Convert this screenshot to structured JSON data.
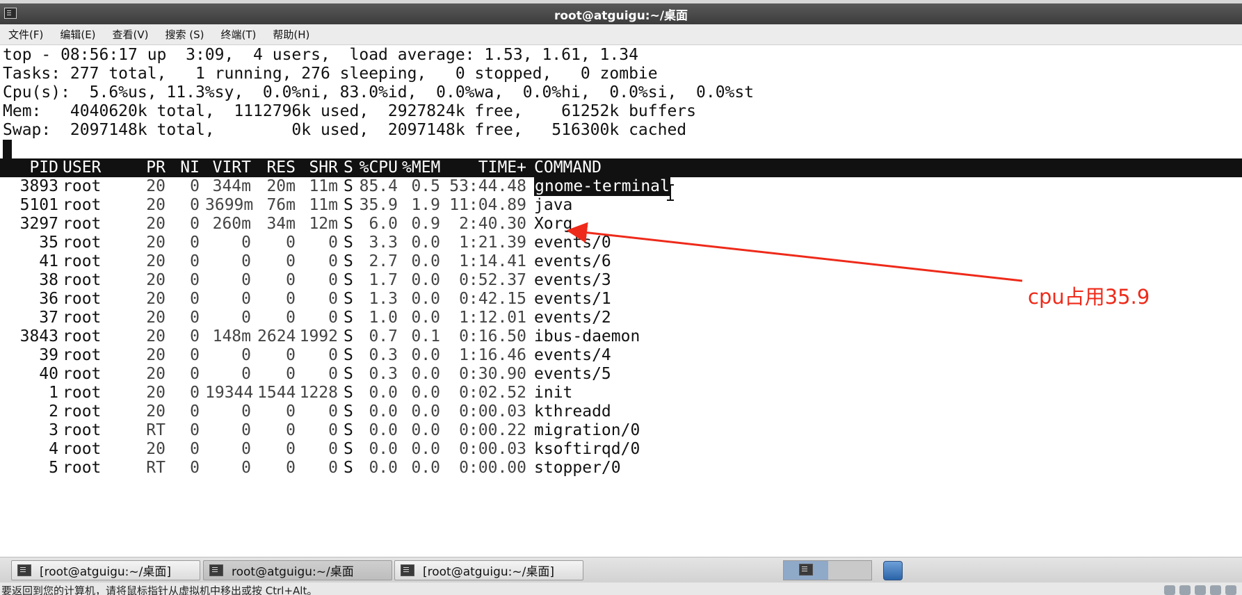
{
  "window": {
    "title": "root@atguigu:~/桌面"
  },
  "menubar": {
    "items": [
      "文件(F)",
      "编辑(E)",
      "查看(V)",
      "搜索 (S)",
      "终端(T)",
      "帮助(H)"
    ]
  },
  "top_summary": {
    "line1": "top - 08:56:17 up  3:09,  4 users,  load average: 1.53, 1.61, 1.34",
    "line2": "Tasks: 277 total,   1 running, 276 sleeping,   0 stopped,   0 zombie",
    "line3": "Cpu(s):  5.6%us, 11.3%sy,  0.0%ni, 83.0%id,  0.0%wa,  0.0%hi,  0.0%si,  0.0%st",
    "line4": "Mem:   4040620k total,  1112796k used,  2927824k free,    61252k buffers",
    "line5": "Swap:  2097148k total,        0k used,  2097148k free,   516300k cached"
  },
  "process_table": {
    "columns": [
      "PID",
      "USER",
      "PR",
      "NI",
      "VIRT",
      "RES",
      "SHR",
      "S",
      "%CPU",
      "%MEM",
      "TIME+",
      "COMMAND"
    ],
    "rows": [
      {
        "pid": "3893",
        "user": "root",
        "pr": "20",
        "ni": "0",
        "virt": "344m",
        "res": "20m",
        "shr": "11m",
        "s": "S",
        "cpu": "85.4",
        "mem": "0.5",
        "time": "53:44.48",
        "command": "gnome-terminal",
        "selected": true
      },
      {
        "pid": "5101",
        "user": "root",
        "pr": "20",
        "ni": "0",
        "virt": "3699m",
        "res": "76m",
        "shr": "11m",
        "s": "S",
        "cpu": "35.9",
        "mem": "1.9",
        "time": "11:04.89",
        "command": "java"
      },
      {
        "pid": "3297",
        "user": "root",
        "pr": "20",
        "ni": "0",
        "virt": "260m",
        "res": "34m",
        "shr": "12m",
        "s": "S",
        "cpu": "6.0",
        "mem": "0.9",
        "time": "2:40.30",
        "command": "Xorg"
      },
      {
        "pid": "35",
        "user": "root",
        "pr": "20",
        "ni": "0",
        "virt": "0",
        "res": "0",
        "shr": "0",
        "s": "S",
        "cpu": "3.3",
        "mem": "0.0",
        "time": "1:21.39",
        "command": "events/0"
      },
      {
        "pid": "41",
        "user": "root",
        "pr": "20",
        "ni": "0",
        "virt": "0",
        "res": "0",
        "shr": "0",
        "s": "S",
        "cpu": "2.7",
        "mem": "0.0",
        "time": "1:14.41",
        "command": "events/6"
      },
      {
        "pid": "38",
        "user": "root",
        "pr": "20",
        "ni": "0",
        "virt": "0",
        "res": "0",
        "shr": "0",
        "s": "S",
        "cpu": "1.7",
        "mem": "0.0",
        "time": "0:52.37",
        "command": "events/3"
      },
      {
        "pid": "36",
        "user": "root",
        "pr": "20",
        "ni": "0",
        "virt": "0",
        "res": "0",
        "shr": "0",
        "s": "S",
        "cpu": "1.3",
        "mem": "0.0",
        "time": "0:42.15",
        "command": "events/1"
      },
      {
        "pid": "37",
        "user": "root",
        "pr": "20",
        "ni": "0",
        "virt": "0",
        "res": "0",
        "shr": "0",
        "s": "S",
        "cpu": "1.0",
        "mem": "0.0",
        "time": "1:12.01",
        "command": "events/2"
      },
      {
        "pid": "3843",
        "user": "root",
        "pr": "20",
        "ni": "0",
        "virt": "148m",
        "res": "2624",
        "shr": "1992",
        "s": "S",
        "cpu": "0.7",
        "mem": "0.1",
        "time": "0:16.50",
        "command": "ibus-daemon"
      },
      {
        "pid": "39",
        "user": "root",
        "pr": "20",
        "ni": "0",
        "virt": "0",
        "res": "0",
        "shr": "0",
        "s": "S",
        "cpu": "0.3",
        "mem": "0.0",
        "time": "1:16.46",
        "command": "events/4"
      },
      {
        "pid": "40",
        "user": "root",
        "pr": "20",
        "ni": "0",
        "virt": "0",
        "res": "0",
        "shr": "0",
        "s": "S",
        "cpu": "0.3",
        "mem": "0.0",
        "time": "0:30.90",
        "command": "events/5"
      },
      {
        "pid": "1",
        "user": "root",
        "pr": "20",
        "ni": "0",
        "virt": "19344",
        "res": "1544",
        "shr": "1228",
        "s": "S",
        "cpu": "0.0",
        "mem": "0.0",
        "time": "0:02.52",
        "command": "init"
      },
      {
        "pid": "2",
        "user": "root",
        "pr": "20",
        "ni": "0",
        "virt": "0",
        "res": "0",
        "shr": "0",
        "s": "S",
        "cpu": "0.0",
        "mem": "0.0",
        "time": "0:00.03",
        "command": "kthreadd"
      },
      {
        "pid": "3",
        "user": "root",
        "pr": "RT",
        "ni": "0",
        "virt": "0",
        "res": "0",
        "shr": "0",
        "s": "S",
        "cpu": "0.0",
        "mem": "0.0",
        "time": "0:00.22",
        "command": "migration/0"
      },
      {
        "pid": "4",
        "user": "root",
        "pr": "20",
        "ni": "0",
        "virt": "0",
        "res": "0",
        "shr": "0",
        "s": "S",
        "cpu": "0.0",
        "mem": "0.0",
        "time": "0:00.03",
        "command": "ksoftirqd/0"
      },
      {
        "pid": "5",
        "user": "root",
        "pr": "RT",
        "ni": "0",
        "virt": "0",
        "res": "0",
        "shr": "0",
        "s": "S",
        "cpu": "0.0",
        "mem": "0.0",
        "time": "0:00.00",
        "command": "stopper/0"
      }
    ]
  },
  "annotation": {
    "text": "cpu占用35.9",
    "color": "#ee2a1a"
  },
  "taskbar": {
    "buttons": [
      {
        "label": "[root@atguigu:~/桌面]",
        "active": false
      },
      {
        "label": "root@atguigu:~/桌面",
        "active": true
      },
      {
        "label": "[root@atguigu:~/桌面]",
        "active": false
      }
    ]
  },
  "statusbar": {
    "text": "要返回到您的计算机，请将鼠标指针从虚拟机中移出或按 Ctrl+Alt。"
  }
}
